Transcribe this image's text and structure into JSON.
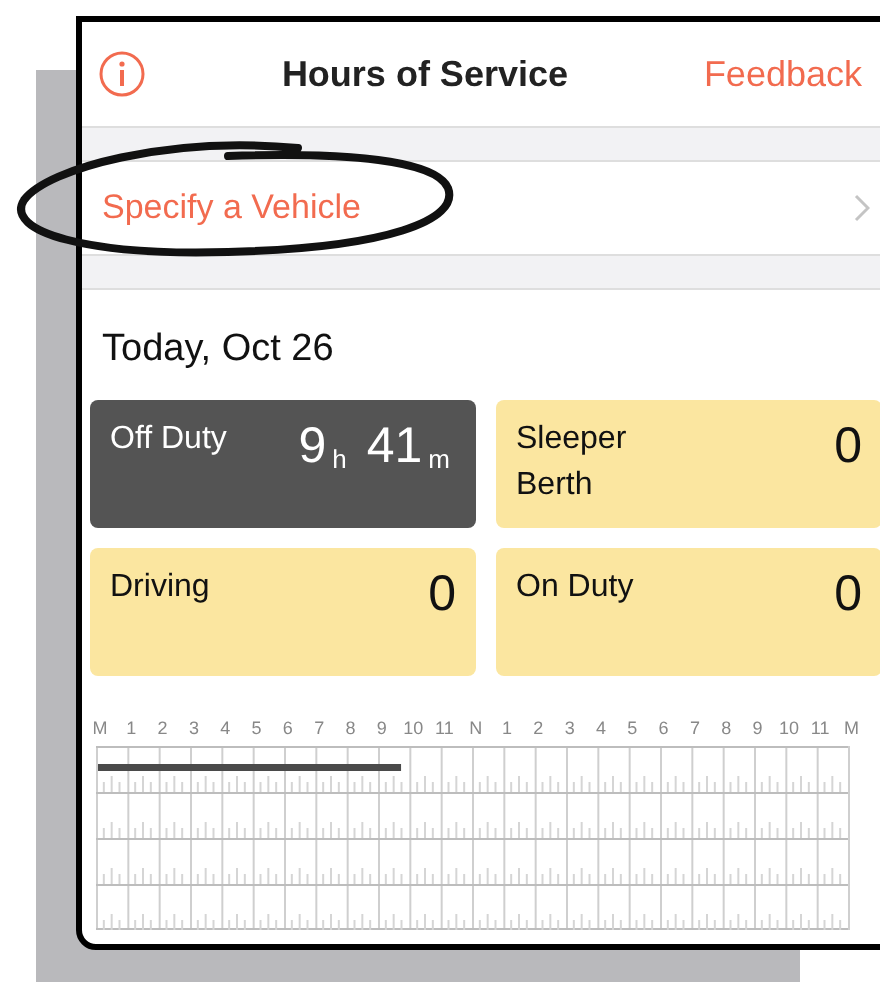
{
  "header": {
    "title": "Hours of Service",
    "action": "Feedback"
  },
  "vehicle_row": {
    "label": "Specify a Vehicle"
  },
  "date": "Today, Oct 26",
  "cards": [
    {
      "label": "Off Duty",
      "value": "9$_{h}$ 41$_{m}$",
      "selected": true
    },
    {
      "label": "Sleeper Berth",
      "value": "0",
      "selected": false
    },
    {
      "label": "Driving",
      "value": "0",
      "selected": false
    },
    {
      "label": "On Duty",
      "value": "0",
      "selected": false
    }
  ],
  "log": {
    "hour_labels": [
      "M",
      "1",
      "2",
      "3",
      "4",
      "5",
      "6",
      "7",
      "8",
      "9",
      "10",
      "11",
      "N",
      "1",
      "2",
      "3",
      "4",
      "5",
      "6",
      "7",
      "8",
      "9",
      "10",
      "11",
      "M"
    ],
    "off_duty_line": {
      "level": 0.403
    }
  }
}
